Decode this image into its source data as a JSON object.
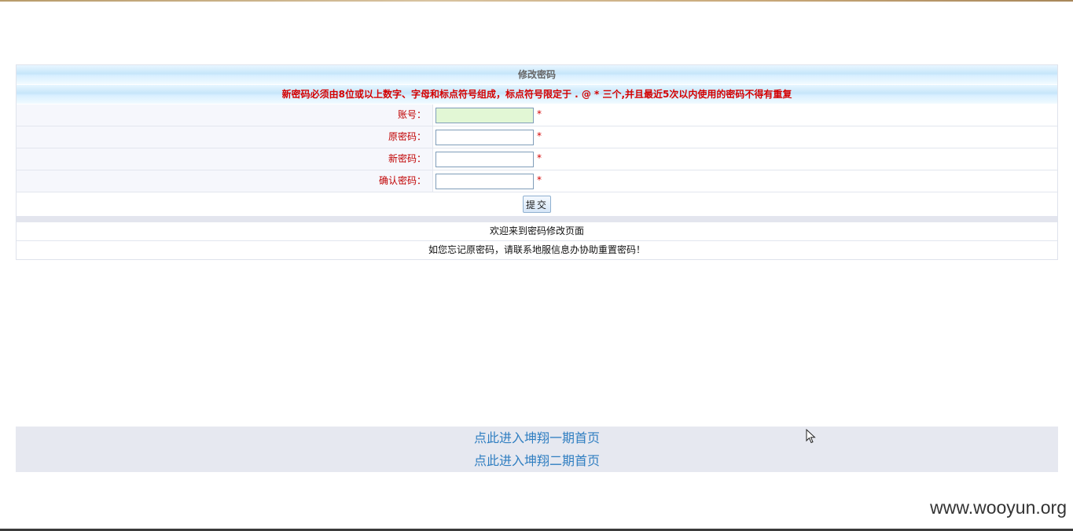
{
  "form": {
    "title": "修改密码",
    "notice": "新密码必须由8位或以上数字、字母和标点符号组成，标点符号限定于 . @ * 三个,并且最近5次以内使用的密码不得有重复",
    "fields": [
      {
        "label": "账号：",
        "value": "",
        "required": "*"
      },
      {
        "label": "原密码：",
        "value": "",
        "required": "*"
      },
      {
        "label": "新密码：",
        "value": "",
        "required": "*"
      },
      {
        "label": "确认密码：",
        "value": "",
        "required": "*"
      }
    ],
    "submit_label": "提交"
  },
  "info": {
    "welcome": "欢迎来到密码修改页面",
    "help": "如您忘记原密码，请联系地服信息办协助重置密码！"
  },
  "links": {
    "phase1": "点此进入坤翔一期首页",
    "phase2": "点此进入坤翔二期首页"
  },
  "watermark": "www.wooyun.org",
  "colors": {
    "notice_red": "#d40000",
    "link_blue": "#2f7ec1",
    "header_blue": "#c6e6fa",
    "active_input": "#e2f7d5"
  }
}
